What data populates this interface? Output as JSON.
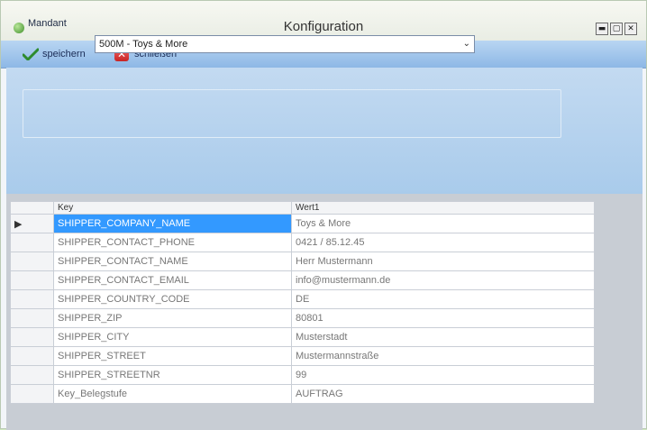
{
  "window": {
    "title": "Konfiguration",
    "controls": [
      "▬",
      "▢",
      "✕"
    ]
  },
  "toolbar": {
    "save_label": "speichern",
    "close_label": "schließen"
  },
  "mandant": {
    "label": "Mandant",
    "selected": "500M - Toys & More"
  },
  "grid": {
    "columns": [
      "Key",
      "Wert1"
    ],
    "current_row_marker": "▶",
    "rows": [
      {
        "key": "SHIPPER_COMPANY_NAME",
        "value": "Toys & More"
      },
      {
        "key": "SHIPPER_CONTACT_PHONE",
        "value": "0421 / 85.12.45"
      },
      {
        "key": "SHIPPER_CONTACT_NAME",
        "value": "Herr Mustermann"
      },
      {
        "key": "SHIPPER_CONTACT_EMAIL",
        "value": "info@mustermann.de"
      },
      {
        "key": "SHIPPER_COUNTRY_CODE",
        "value": "DE"
      },
      {
        "key": "SHIPPER_ZIP",
        "value": "80801"
      },
      {
        "key": "SHIPPER_CITY",
        "value": "Musterstadt"
      },
      {
        "key": "SHIPPER_STREET",
        "value": "Mustermannstraße"
      },
      {
        "key": "SHIPPER_STREETNR",
        "value": "99"
      },
      {
        "key": "Key_Belegstufe",
        "value": "AUFTRAG"
      }
    ]
  }
}
